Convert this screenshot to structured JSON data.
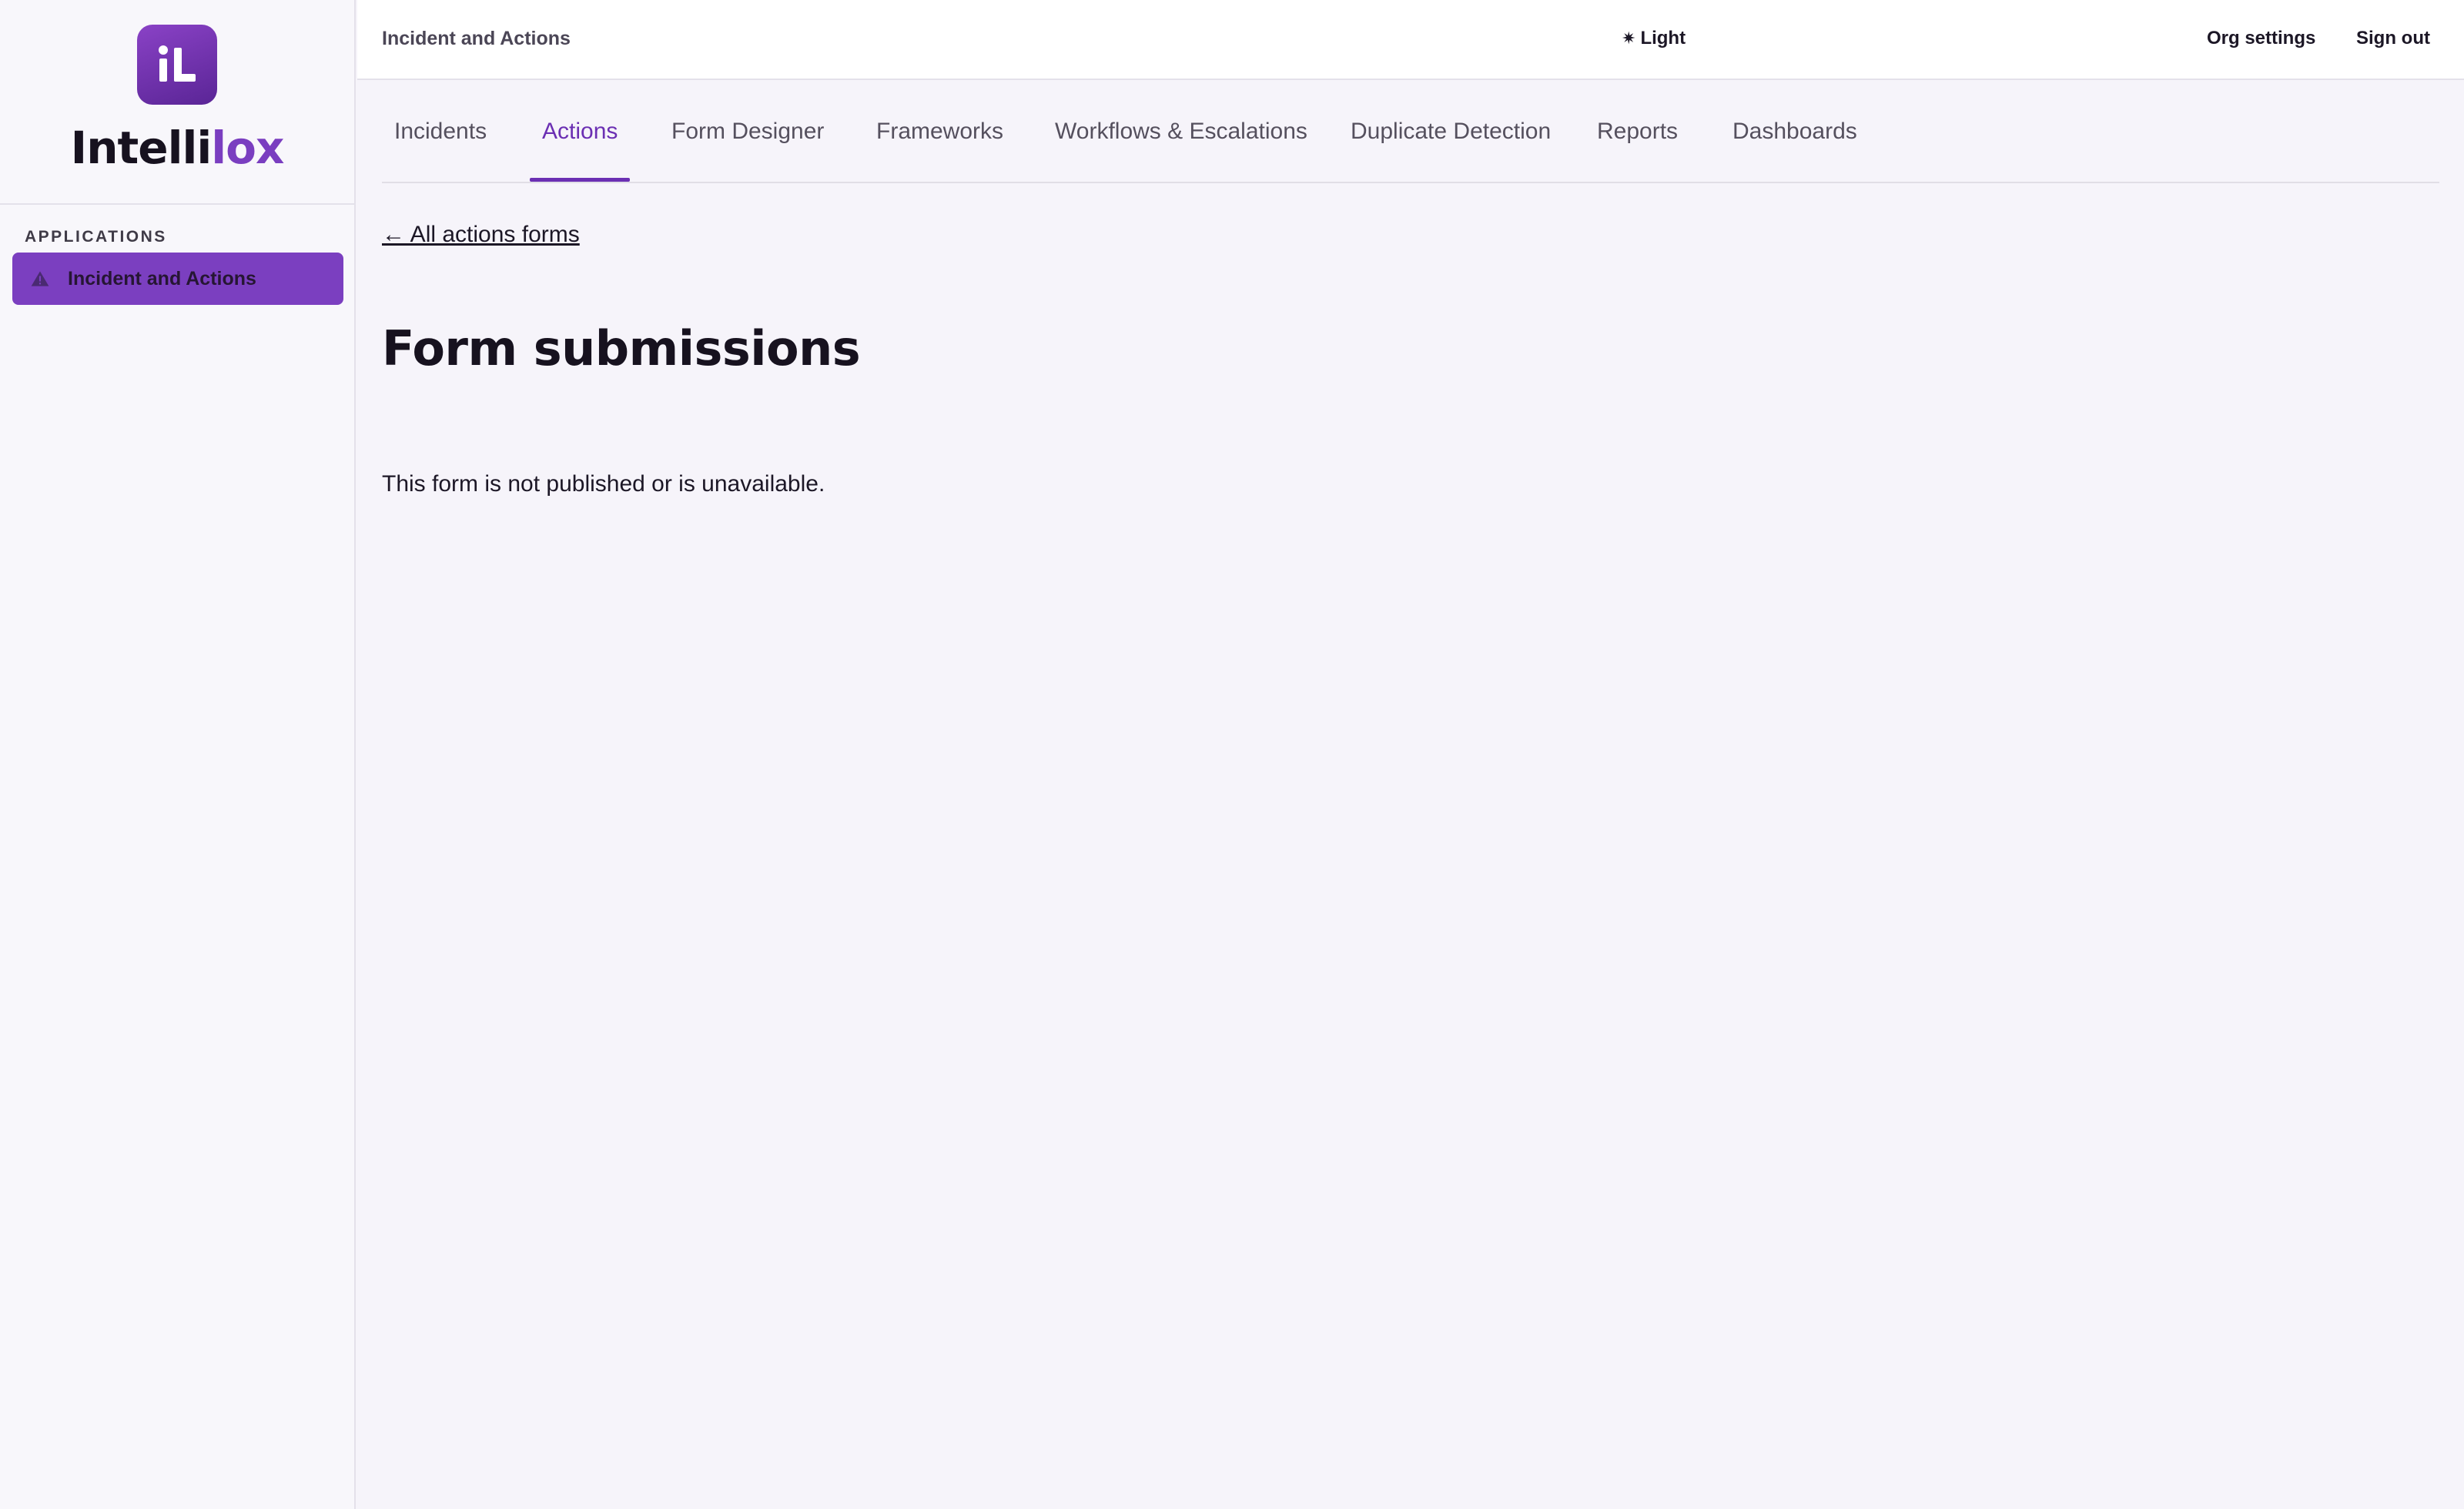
{
  "brand": {
    "mark_text": "iL",
    "name_part1": "Intelli",
    "name_part2": "lox",
    "accent_color": "#7a3ec0"
  },
  "sidebar": {
    "section_label": "APPLICATIONS",
    "items": [
      {
        "label": "Incident and Actions",
        "icon": "warning-icon",
        "active": true
      }
    ]
  },
  "header": {
    "app_title": "Incident and Actions",
    "theme_icon": "sun-icon",
    "theme_label": "Light",
    "org_settings": "Org settings",
    "sign_out": "Sign out"
  },
  "tabs": [
    {
      "label": "Incidents"
    },
    {
      "label": "Actions",
      "active": true
    },
    {
      "label": "Form Designer"
    },
    {
      "label": "Frameworks"
    },
    {
      "label": "Workflows & Escalations"
    },
    {
      "label": "Duplicate Detection"
    },
    {
      "label": "Reports"
    },
    {
      "label": "Dashboards"
    }
  ],
  "main": {
    "back_link": "← All actions forms",
    "title": "Form submissions",
    "message": "This form is not published or is unavailable."
  }
}
